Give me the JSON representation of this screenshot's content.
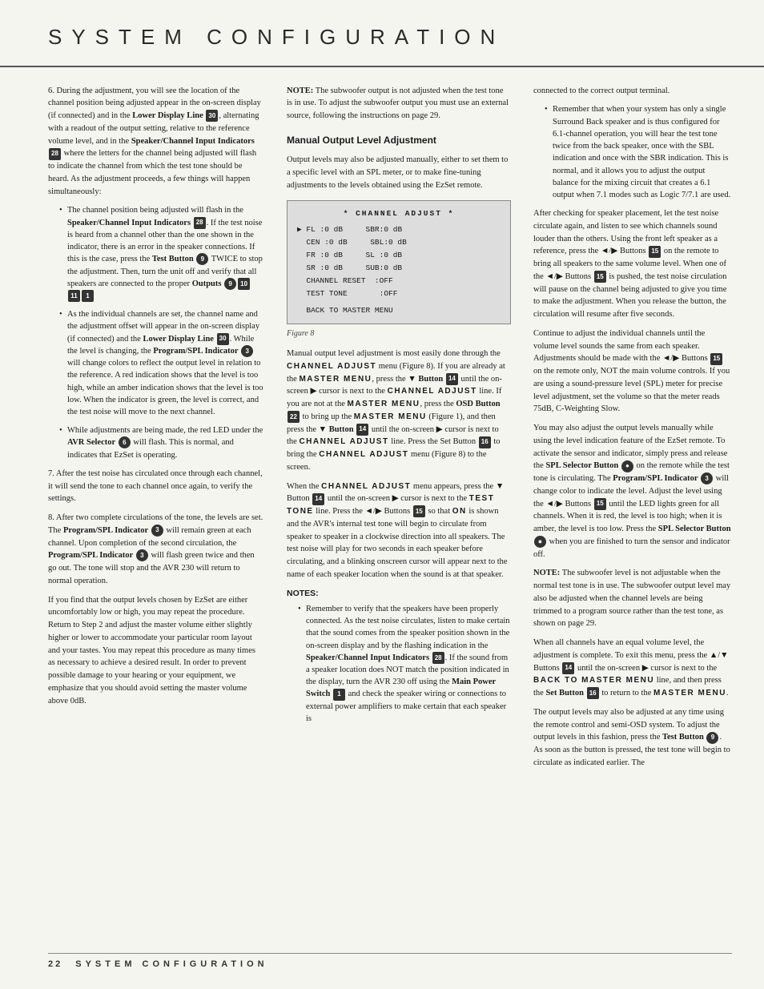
{
  "page": {
    "title": "SYSTEM CONFIGURATION",
    "footer_page": "22",
    "footer_section": "SYSTEM CONFIGURATION"
  },
  "left_column": {
    "intro_text": "6. During the adjustment, you will see the location of the channel position being adjusted appear in the on-screen display (if connected) and in the",
    "lower_display_label": "Lower Display Line",
    "lower_display_num": "30",
    "intro_cont": ", alternating with a readout of the output setting, relative to the reference volume level, and in the",
    "speaker_channel_label": "Speaker/Channel Input Indicators",
    "speaker_channel_num": "28",
    "intro_end": "where the letters for the channel being adjusted will flash to indicate the channel from which the test tone should be heard. As the adjustment proceeds, a few things will happen simultaneously:",
    "bullets": [
      {
        "text_before": "The channel position being adjusted will flash in the",
        "bold1": "Speaker/Channel Input Indicators",
        "num1": "28",
        "text_mid": ". If the test noise is heard from a channel other than the one shown in the indicator, there is an error in the speaker connections. If this is the case, press the",
        "bold2": "Test Button",
        "num2": "9",
        "text_mid2": "TWICE to stop the adjustment. Then, turn the unit off and verify that all speakers are connected to the proper",
        "bold3": "Outputs",
        "num3a": "9",
        "num3b": "10",
        "num3c": "11",
        "num3d": "1"
      },
      {
        "text_before": "As the individual channels are set, the channel name and the adjustment offset will appear in the on-screen display (if connected) and the",
        "bold1": "Lower Display Line",
        "num1": "30",
        "text_mid": ". While the level is changing, the",
        "bold2": "Program/SPL Indicator",
        "num2": "3",
        "text_end": "will change colors to reflect the output level in relation to the reference. A red indication shows that the level is too high, while an amber indication shows that the level is too low. When the indicator is green, the level is correct, and the test noise will move to the next channel."
      },
      {
        "text_before": "While adjustments are being made, the red LED under the",
        "bold1": "AVR Selector",
        "num1": "6",
        "text_end": "will flash. This is normal, and indicates that EzSet is operating."
      }
    ],
    "item7": "7. After the test noise has circulated once through each channel, it will send the tone to each channel once again, to verify the settings.",
    "item8_before": "8. After two complete circulations of the tone, the levels are set. The",
    "item8_bold1": "Program/SPL Indicator",
    "item8_num1": "3",
    "item8_mid": "will remain green at each channel. Upon completion of the second circulation, the",
    "item8_bold2": "Program/SPL Indicator",
    "item8_num2": "3",
    "item8_end": "will flash green twice and then go out. The tone will stop and the AVR 230 will return to normal operation.",
    "closing_para": "If you find that the output levels chosen by EzSet are either uncomfortably low or high, you may repeat the procedure. Return to Step 2 and adjust the master volume either slightly higher or lower to accommodate your particular room layout and your tastes. You may repeat this procedure as many times as necessary to achieve a desired result. In order to prevent possible damage to your hearing or your equipment, we emphasize that you should avoid setting the master volume above 0dB."
  },
  "middle_column": {
    "note_subwoofer": "NOTE: The subwoofer output is not adjusted when the test tone is in use. To adjust the subwoofer output you must use an external source, following the instructions on page 29.",
    "section_heading": "Manual Output Level Adjustment",
    "section_intro": "Output levels may also be adjusted manually, either to set them to a specific level with an SPL meter, or to make fine-tuning adjustments to the levels obtained using the EzSet remote.",
    "channel_display": {
      "header": "* CHANNEL ADJUST *",
      "arrow": "▶",
      "rows": [
        {
          "left": "FL  :0  dB",
          "right": "SBR:0  dB"
        },
        {
          "left": "CEN :0  dB",
          "right": "SBL:0  dB"
        },
        {
          "left": "FR  :0  dB",
          "right": "SL :0  dB"
        },
        {
          "left": "SR  :0  dB",
          "right": "SUB:0  dB"
        },
        {
          "left": "CHANNEL RESET",
          "right": ":OFF"
        },
        {
          "left": "TEST TONE",
          "right": ":OFF"
        }
      ],
      "back_row": "BACK TO MASTER MENU"
    },
    "figure_caption": "Figure 8",
    "body_text_1": "Manual output level adjustment is most easily done through the",
    "channel_adjust_sc": "CHANNEL ADJUST",
    "body_text_2": "menu (Figure 8). If you are already at the",
    "master_menu_sc": "MASTER MENU",
    "body_text_3": ", press the",
    "button_down": "▼ Button",
    "button_num": "14",
    "body_text_4": "until the on-screen ▶ cursor is next to the",
    "channel_adjust_sc2": "CHANNEL ADJUST",
    "body_text_5": "line. If you are not at the",
    "master_menu_sc2": "MASTER MENU",
    "body_text_6": ", press the",
    "osd_button": "OSD Button",
    "osd_num": "22",
    "body_text_7": "to bring up the",
    "master_menu_sc3": "MASTER MENU",
    "body_text_8": "(Figure 1), and then press the",
    "body_text_9": "▼ Button",
    "button_num2": "14",
    "body_text_10": "until the on-screen ▶ cursor is next to the",
    "channel_adjust_sc3": "CHANNEL ADJUST",
    "body_text_11": "line. Press the Set Button",
    "set_button_num": "16",
    "body_text_12": "to bring the",
    "channel_adjust_sc4": "CHANNEL ADJUST",
    "body_text_13": "menu (Figure 8) to the screen.",
    "body_text_14": "When the",
    "channel_adjust_sc5": "CHANNEL ADJUST",
    "body_text_15": "menu appears, press the ▼ Button",
    "button_num3": "14",
    "body_text_16": "until the on-screen ▶ cursor is next to the",
    "test_tone_sc": "TEST TONE",
    "body_text_17": "line. Press the ◄/▶ Buttons",
    "button_num4": "15",
    "body_text_18": "so that",
    "on_sc": "ON",
    "body_text_19": "is shown and the AVR's internal test tone will begin to circulate from speaker to speaker in a clockwise direction into all speakers. The test noise will play for two seconds in each speaker before circulating, and a blinking onscreen cursor will appear next to the name of each speaker location when the sound is at that speaker."
  },
  "notes_section": {
    "label": "NOTES:",
    "bullets": [
      {
        "text": "Remember to verify that the speakers have been properly connected. As the test noise circulates, listen to make certain that the sound comes from the speaker position shown in the on-screen display and by the flashing indication in the",
        "bold1": "Speaker/Channel Input Indicators",
        "num1": "28",
        "text_end": ". If the sound from a speaker location does NOT match the position indicated in the display, turn the AVR 230 off using the",
        "bold2": "Main Power Switch",
        "num2": "1",
        "text_end2": "and check the speaker wiring or connections to external power amplifiers to make certain that each speaker is"
      }
    ]
  },
  "right_column": {
    "text_1": "connected to the correct output terminal.",
    "bullet1": {
      "text": "Remember that when your system has only a single Surround Back speaker and is thus configured for 6.1-channel operation, you will hear the test tone twice from the back speaker, once with the SBL indication and once with the SBR indication. This is normal, and it allows you to adjust the output balance for the mixing circuit that creates a 6.1 output when 7.1 modes such as Logic 7/7.1 are used."
    },
    "para2": "After checking for speaker placement, let the test noise circulate again, and listen to see which channels sound louder than the others. Using the front left speaker as a reference, press the ◄/▶ Buttons",
    "para2_num": "15",
    "para2_cont": "on the remote to bring all speakers to the same volume level. When one of the ◄/▶ Buttons",
    "para2_num2": "15",
    "para2_cont2": "is pushed, the test noise circulation will pause on the channel being adjusted to give you time to make the adjustment. When you release the button, the circulation will resume after five seconds.",
    "para3": "Continue to adjust the individual channels until the volume level sounds the same from each speaker. Adjustments should be made with the ◄/▶ Buttons",
    "para3_num": "15",
    "para3_cont": "on the remote only, NOT the main volume controls. If you are using a sound-pressure level (SPL) meter for precise level adjustment, set the volume so that the meter reads 75dB, C-Weighting Slow.",
    "para4": "You may also adjust the output levels manually while using the level indication feature of the EzSet remote. To activate the sensor and indicator, simply press and release the",
    "para4_bold": "SPL Selector Button",
    "para4_circle": "●",
    "para4_cont": "on the remote while the test tone is circulating. The",
    "para4_bold2": "Program/SPL Indicator",
    "para4_num": "3",
    "para4_cont2": "will change color to indicate the level. Adjust the level using the ◄/▶ Buttons",
    "para4_num2": "15",
    "para4_cont3": "until the LED lights green for all channels. When it is red, the level is too high; when it is amber, the level is too low. Press the",
    "para4_bold3": "SPL Selector Button",
    "para4_circle2": "●",
    "para4_cont4": "when you are finished to turn the sensor and indicator off.",
    "note_text": "NOTE: The subwoofer level is not adjustable when the normal test tone is in use. The subwoofer output level may also be adjusted when the channel levels are being trimmed to a program source rather than the test tone, as shown on page 29.",
    "para5": "When all channels have an equal volume level, the adjustment is complete. To exit this menu, press the ▲/▼ Buttons",
    "para5_num": "14",
    "para5_cont": "until the on-screen ▶ cursor is next to the",
    "back_to_master_sc": "BACK TO MASTER MENU",
    "para5_cont2": "line, and then press the",
    "set_button_label": "Set Button",
    "set_num": "16",
    "para5_cont3": "to return to the",
    "master_menu_final": "MASTER MENU",
    "para6": "The output levels may also be adjusted at any time using the remote control and semi-OSD system. To adjust the output levels in this fashion, press the",
    "test_button_label": "Test Button",
    "test_num": "9",
    "para6_cont": ". As soon as the button is pressed, the test tone will begin to circulate as indicated earlier. The"
  }
}
